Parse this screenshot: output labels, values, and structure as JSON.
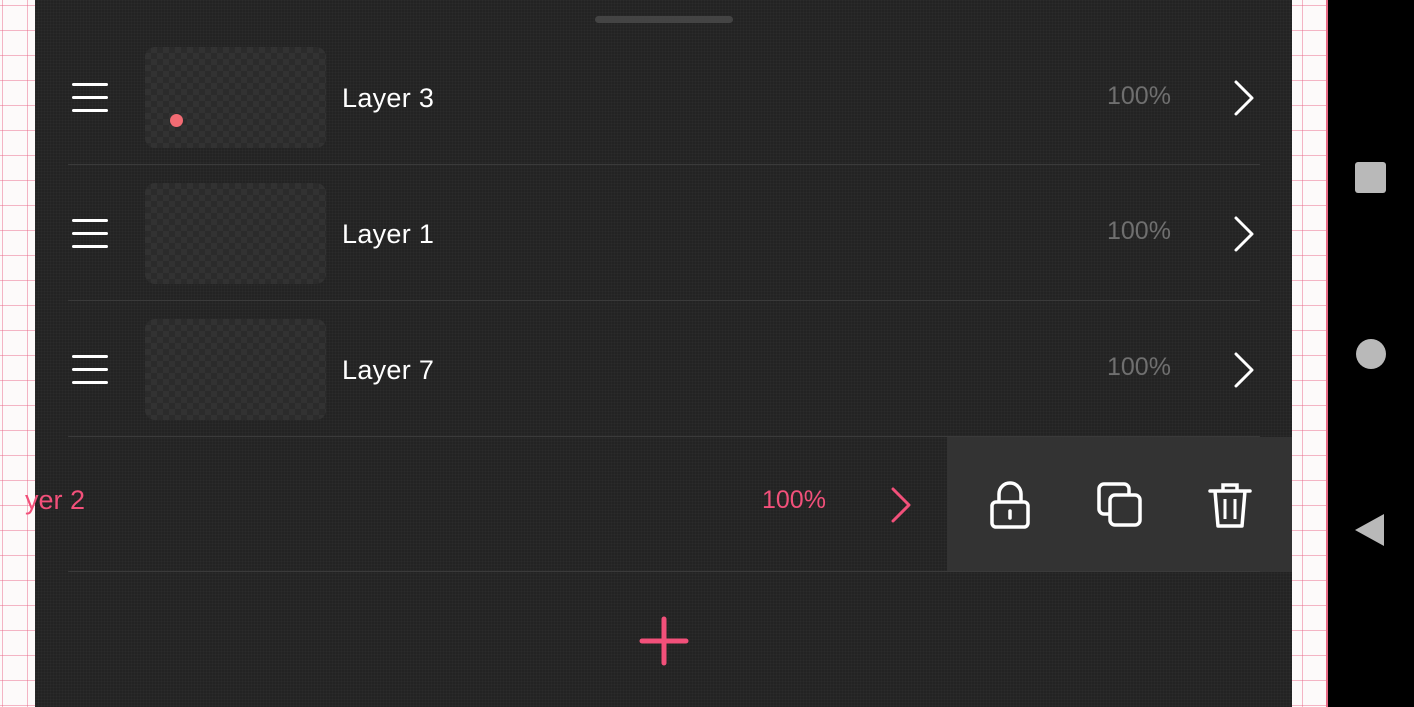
{
  "colors": {
    "accent": "#f2507a",
    "panel_bg": "#232323",
    "action_bg": "#333333",
    "text": "#ffffff",
    "muted_text": "#6f6f6f",
    "thumb_dot": "#f26b73"
  },
  "layers": [
    {
      "name": "Layer 3",
      "opacity": "100%"
    },
    {
      "name": "Layer 1",
      "opacity": "100%"
    },
    {
      "name": "Layer 7",
      "opacity": "100%"
    }
  ],
  "swiped_layer": {
    "name": "yer 2",
    "opacity": "100%"
  },
  "actions": [
    {
      "icon": "lock-icon"
    },
    {
      "icon": "duplicate-icon"
    },
    {
      "icon": "trash-icon"
    }
  ],
  "add_button": {
    "icon": "plus-icon"
  },
  "system_nav": [
    "recents-button",
    "home-button",
    "back-button"
  ]
}
